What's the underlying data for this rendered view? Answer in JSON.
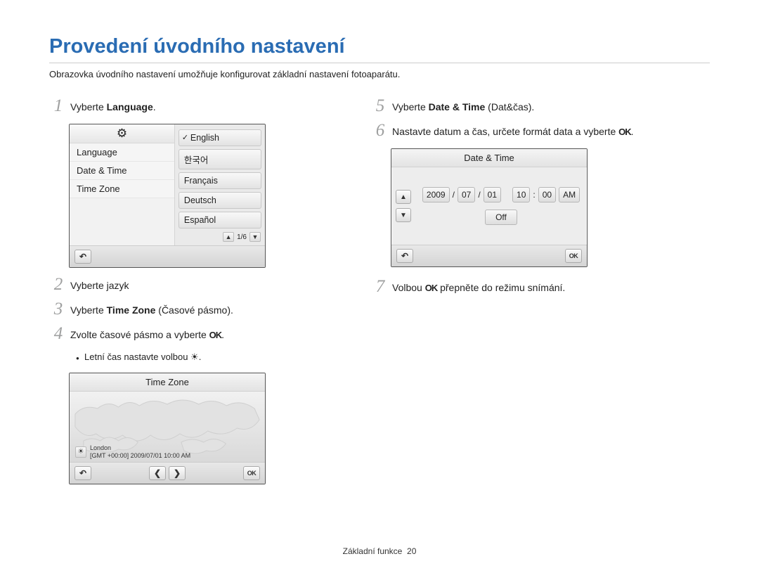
{
  "title": "Provedení úvodního nastavení",
  "subtitle": "Obrazovka úvodního nastavení umožňuje konfigurovat základní nastavení fotoaparátu.",
  "steps": {
    "s1_prefix": "Vyberte ",
    "s1_bold": "Language",
    "s1_suffix": ".",
    "s2": "Vyberte jazyk",
    "s3_prefix": "Vyberte ",
    "s3_bold": "Time Zone",
    "s3_suffix": " (Časové pásmo).",
    "s4_prefix": "Zvolte časové pásmo a vyberte ",
    "s4_suffix": ".",
    "s4_bullet_prefix": "Letní čas nastavte volbou ",
    "s4_bullet_suffix": ".",
    "s5_prefix": "Vyberte ",
    "s5_bold": "Date & Time",
    "s5_suffix": " (Dat&čas).",
    "s6_prefix": "Nastavte datum a čas, určete formát data a vyberte ",
    "s6_suffix": ".",
    "s7_prefix": "Volbou ",
    "s7_suffix": " přepněte do režimu snímání."
  },
  "glyphs": {
    "ok": "OK",
    "sun": "☀",
    "back": "↶",
    "gear": "⚙",
    "up": "▲",
    "down": "▼",
    "left": "❮",
    "right": "❯",
    "check": "✓"
  },
  "lang": {
    "menu": [
      "Language",
      "Date & Time",
      "Time Zone"
    ],
    "options": [
      "English",
      "한국어",
      "Français",
      "Deutsch",
      "Español"
    ],
    "pager": "1/6"
  },
  "tz": {
    "title": "Time Zone",
    "city": "London",
    "status": "[GMT +00:00] 2009/07/01 10:00 AM"
  },
  "dt": {
    "title": "Date & Time",
    "year": "2009",
    "month": "07",
    "day": "01",
    "hour": "10",
    "minute": "00",
    "ampm": "AM",
    "slash": "/",
    "colon": ":",
    "off": "Off"
  },
  "footer": {
    "section": "Základní funkce",
    "page": "20"
  }
}
